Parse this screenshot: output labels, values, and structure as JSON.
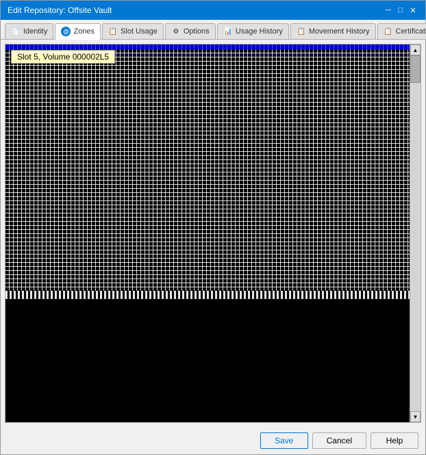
{
  "window": {
    "title": "Edit Repository: Offsite Vault",
    "close_btn": "✕"
  },
  "tabs": [
    {
      "id": "identity",
      "label": "Identity",
      "icon_type": "page",
      "active": false
    },
    {
      "id": "zones",
      "label": "Zones",
      "icon_type": "blue-circle",
      "active": true
    },
    {
      "id": "slot-usage",
      "label": "Slot Usage",
      "icon_type": "page",
      "active": false
    },
    {
      "id": "options",
      "label": "Options",
      "icon_type": "gear",
      "active": false
    },
    {
      "id": "usage-history",
      "label": "Usage History",
      "icon_type": "page",
      "active": false
    },
    {
      "id": "movement-history",
      "label": "Movement History",
      "icon_type": "page",
      "active": false
    },
    {
      "id": "certification",
      "label": "Certification",
      "icon_type": "page",
      "active": false
    }
  ],
  "slot_tooltip": "Slot 5, Volume 000002L5",
  "footer": {
    "save_label": "Save",
    "cancel_label": "Cancel",
    "help_label": "Help"
  }
}
